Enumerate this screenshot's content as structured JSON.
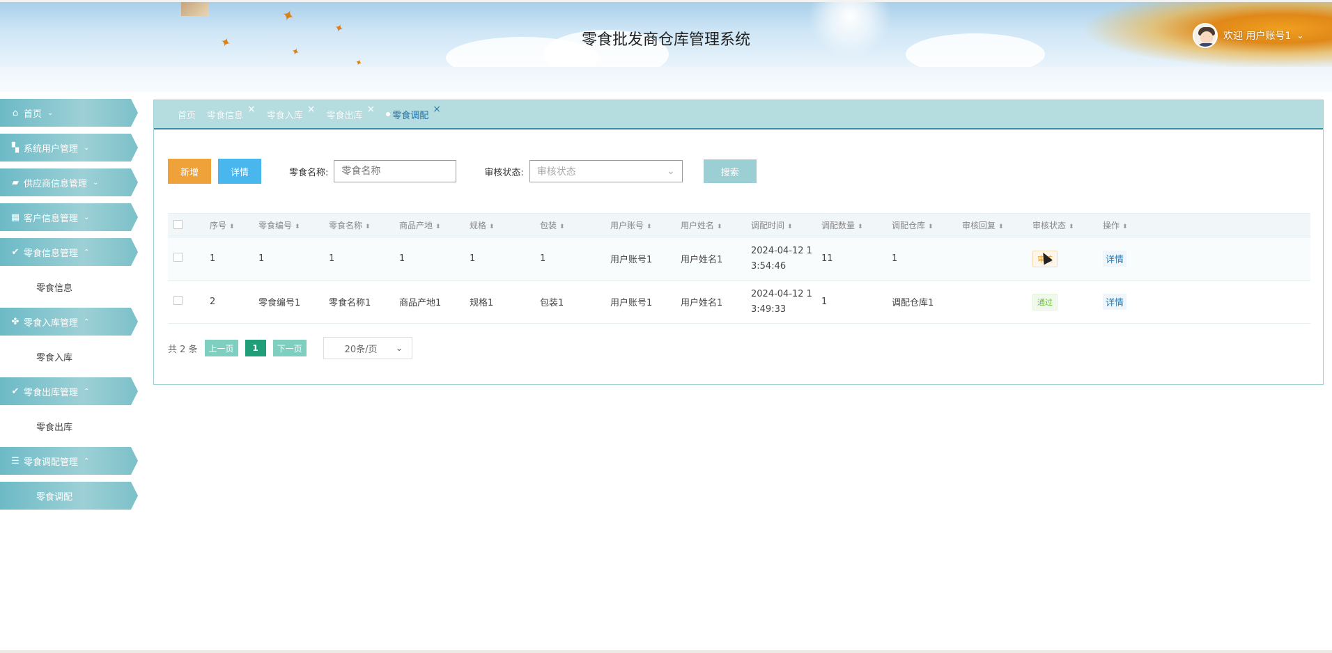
{
  "header": {
    "title": "零食批发商仓库管理系统",
    "welcome": "欢迎 用户账号1",
    "user_caret_icon": "chevron-down-icon"
  },
  "sidebar": {
    "items": [
      {
        "label": "首页",
        "icon": "home-icon",
        "chevron": "⌄"
      },
      {
        "label": "系统用户管理",
        "icon": "crop-icon",
        "chevron": "⌄"
      },
      {
        "label": "供应商信息管理",
        "icon": "folder-icon",
        "chevron": "⌄"
      },
      {
        "label": "客户信息管理",
        "icon": "dashboard-icon",
        "chevron": "⌄"
      },
      {
        "label": "零食信息管理",
        "icon": "check-circle-icon",
        "chevron": "⌃"
      },
      {
        "label": "零食信息",
        "sub": true
      },
      {
        "label": "零食入库管理",
        "icon": "grid-icon",
        "chevron": "⌃"
      },
      {
        "label": "零食入库",
        "sub": true
      },
      {
        "label": "零食出库管理",
        "icon": "check-circle-icon",
        "chevron": "⌃"
      },
      {
        "label": "零食出库",
        "sub": true
      },
      {
        "label": "零食调配管理",
        "icon": "list-icon",
        "chevron": "⌃"
      },
      {
        "label": "零食调配",
        "sub": true,
        "active": true
      }
    ]
  },
  "tabs": [
    {
      "label": "首页",
      "closable": false
    },
    {
      "label": "零食信息",
      "closable": true
    },
    {
      "label": "零食入库",
      "closable": true
    },
    {
      "label": "零食出库",
      "closable": true
    },
    {
      "label": "零食调配",
      "closable": true,
      "active": true
    }
  ],
  "tab_close": "×",
  "toolbar": {
    "add_label": "新增",
    "detail_label": "详情",
    "name_label": "零食名称:",
    "name_placeholder": "零食名称",
    "status_label": "审核状态:",
    "status_placeholder": "审核状态",
    "search_label": "搜索"
  },
  "table": {
    "columns": [
      "序号",
      "零食编号",
      "零食名称",
      "商品产地",
      "规格",
      "包装",
      "用户账号",
      "用户姓名",
      "调配时间",
      "调配数量",
      "调配仓库",
      "审核回复",
      "审核状态",
      "操作"
    ],
    "rows": [
      {
        "seq": "1",
        "code": "1",
        "name": "1",
        "origin": "1",
        "spec": "1",
        "pack": "1",
        "account": "用户账号1",
        "username": "用户姓名1",
        "time1": "2024-04-12 1",
        "time2": "3:54:46",
        "qty": "11",
        "warehouse": "1",
        "reply": "",
        "status": "审核",
        "status_type": "pending",
        "action": "详情"
      },
      {
        "seq": "2",
        "code": "零食编号1",
        "name": "零食名称1",
        "origin": "商品产地1",
        "spec": "规格1",
        "pack": "包装1",
        "account": "用户账号1",
        "username": "用户姓名1",
        "time1": "2024-04-12 1",
        "time2": "3:49:33",
        "qty": "1",
        "warehouse": "调配仓库1",
        "reply": "",
        "status": "通过",
        "status_type": "pass",
        "action": "详情"
      }
    ]
  },
  "pager": {
    "total": "共 2 条",
    "prev": "上一页",
    "page": "1",
    "next": "下一页",
    "size": "20条/页"
  }
}
